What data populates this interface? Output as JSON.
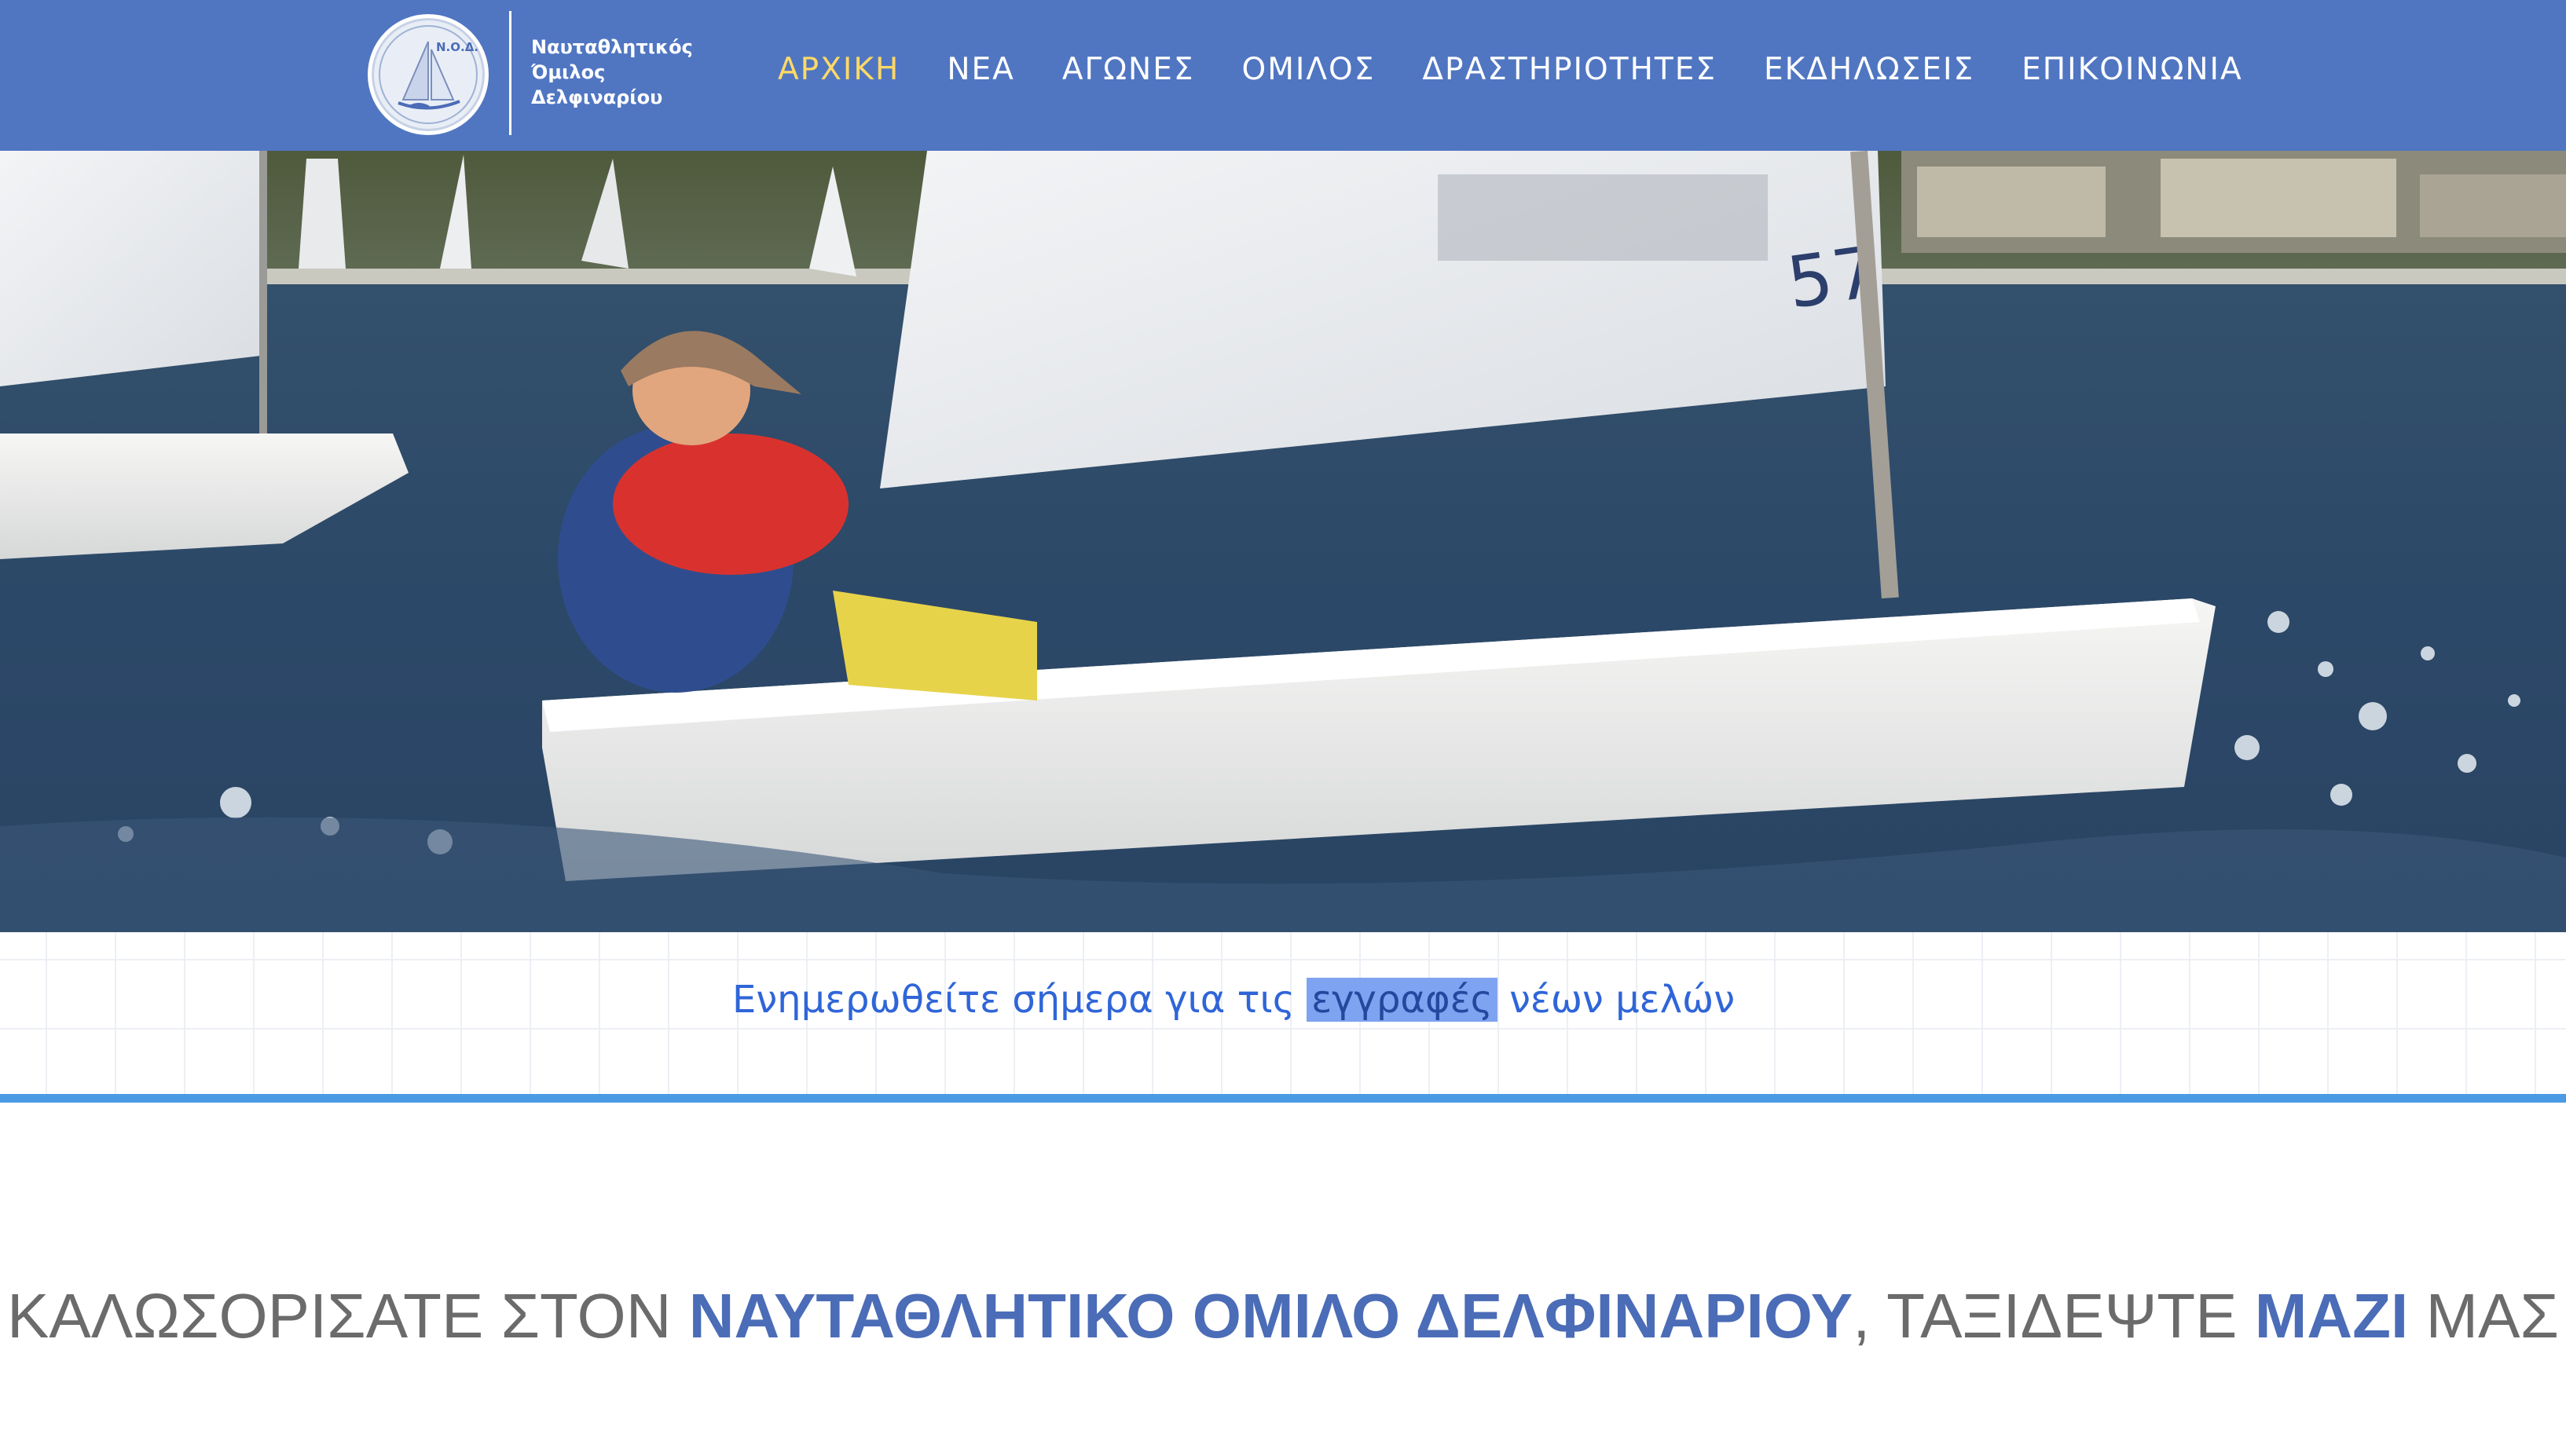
{
  "brand": {
    "logo_initials": "Ν.Ο.Δ.",
    "name_lines": [
      "Ναυταθλητικός",
      "Όμιλος",
      "Δελφιναρίου"
    ]
  },
  "nav": {
    "items": [
      {
        "label": "ΑΡΧΙΚΗ",
        "active": true
      },
      {
        "label": "ΝΕΑ",
        "active": false
      },
      {
        "label": "ΑΓΩΝΕΣ",
        "active": false
      },
      {
        "label": "ΟΜΙΛΟΣ",
        "active": false
      },
      {
        "label": "ΔΡΑΣΤΗΡΙΟΤΗΤΕΣ",
        "active": false
      },
      {
        "label": "ΕΚΔΗΛΩΣΕΙΣ",
        "active": false
      },
      {
        "label": "ΕΠΙΚΟΙΝΩΝΙΑ",
        "active": false
      }
    ]
  },
  "hero": {
    "sail_number": "57"
  },
  "banner": {
    "text_before": "Ενημερωθείτε σήμερα για τις ",
    "text_highlight": "εγγραφές",
    "text_after": " νέων μελών"
  },
  "welcome": {
    "part1": "ΚΑΛΩΣΟΡΙΣΑΤΕ ΣΤΟΝ ",
    "part2_bold": "ΝΑΥΤΑΘΛΗΤΙΚΟ ΟΜΙΛΟ ΔΕΛΦΙΝΑΡΙΟΥ",
    "part3": ", ΤΑΞΙΔΕΨΤΕ ",
    "part4_bold": "ΜΑΖΙ",
    "part5": " ΜΑΣ"
  },
  "colors": {
    "header_bg": "#5076c2",
    "nav_active": "#ffd966",
    "banner_text": "#2f65d8",
    "accent_rule": "#4a9ae4",
    "welcome_bold": "#4b6cb7"
  }
}
